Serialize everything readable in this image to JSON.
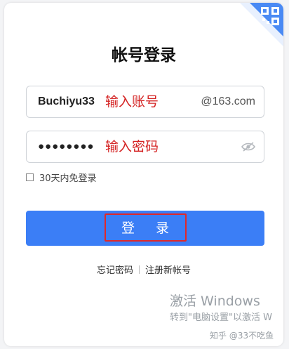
{
  "title": "帐号登录",
  "account": {
    "value": "Buchiyu33",
    "hint": "输入账号",
    "domain": "@163.com"
  },
  "password": {
    "masked": "●●●●●●●●",
    "hint": "输入密码"
  },
  "remember_label": "30天内免登录",
  "login_label": "登 录",
  "links": {
    "forgot": "忘记密码",
    "register": "注册新帐号"
  },
  "watermark": {
    "line1": "激活 Windows",
    "line2": "转到\"电脑设置\"以激活 W",
    "source": "知乎 @33不吃鱼"
  },
  "colors": {
    "button": "#3b7ef6",
    "annotation": "#d42323"
  }
}
